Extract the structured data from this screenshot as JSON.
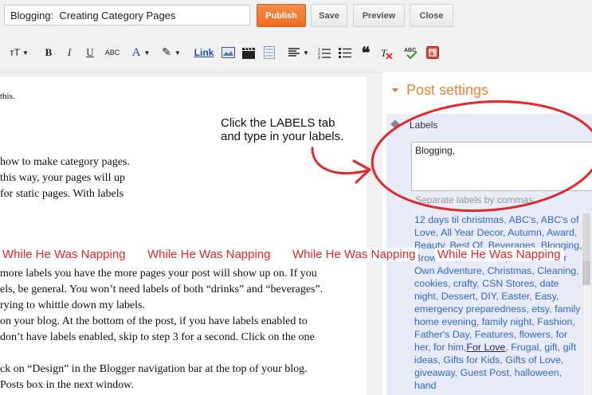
{
  "header": {
    "title_value": "Blogging:  Creating Category Pages",
    "publish_label": "Publish",
    "save_label": "Save",
    "preview_label": "Preview",
    "close_label": "Close"
  },
  "toolbar": {
    "bold": "B",
    "italic": "I",
    "underline": "U",
    "strike": "ABC",
    "text_color": "A",
    "link": "Link",
    "icons": [
      "font-size-icon",
      "bold-icon",
      "italic-icon",
      "underline-icon",
      "strikethrough-icon",
      "text-color-icon",
      "highlight-icon",
      "link-icon",
      "image-icon",
      "video-icon",
      "jump-break-icon",
      "align-icon",
      "numbered-list-icon",
      "bullet-list-icon",
      "quote-icon",
      "clear-format-icon",
      "spellcheck-icon",
      "language-icon"
    ]
  },
  "editor": {
    "lines": [
      "this.",
      "how to make category pages.",
      " this way, your pages will up",
      "for static pages.  With labels",
      " more labels you have the more pages your post will show up on.  If you",
      "els, be general.  You won’t need labels of both “drinks” and “beverages”.",
      "rying to whittle down my labels.",
      "on your blog.  At the bottom of the post, if you have labels enabled to",
      " don’t have labels enabled, skip to step 3 for a second.  Click on the one",
      "ck on “Design” in the Blogger navigation bar at the top of your blog.",
      "Posts box in the next window."
    ],
    "callout": "Click the LABELS tab\nand type in your labels.",
    "watermark": "While He Was Napping"
  },
  "sidebar": {
    "title": "Post settings",
    "labels_heading": "Labels",
    "labels_value": "Blogging,",
    "labels_hint": "Separate labels by commas",
    "suggestions_before": "12 days til christmas, ABC's, ABC's of Love, All Year Decor, Autumn, Award, Beauty, Best Of, Beverages, Blogging, Brownies, Chocolate, Choose Your Own Adventure, Christmas, Cleaning, cookies, crafty, CSN Stores, date night, Dessert, DIY, Easter, Easy, emergency preparedness, etsy, family home evening, family night, Fashion, Father's Day, Features, flowers, for her, for him,",
    "suggestions_underlined": "For Love",
    "suggestions_after": ", Frugal, gift, gift ideas, Gifts for Kids, Gifts of Love, giveaway, Guest Post, halloween, hand"
  },
  "colors": {
    "accent": "#f0843a",
    "annotation": "#e0282d",
    "link": "#3366cc"
  }
}
